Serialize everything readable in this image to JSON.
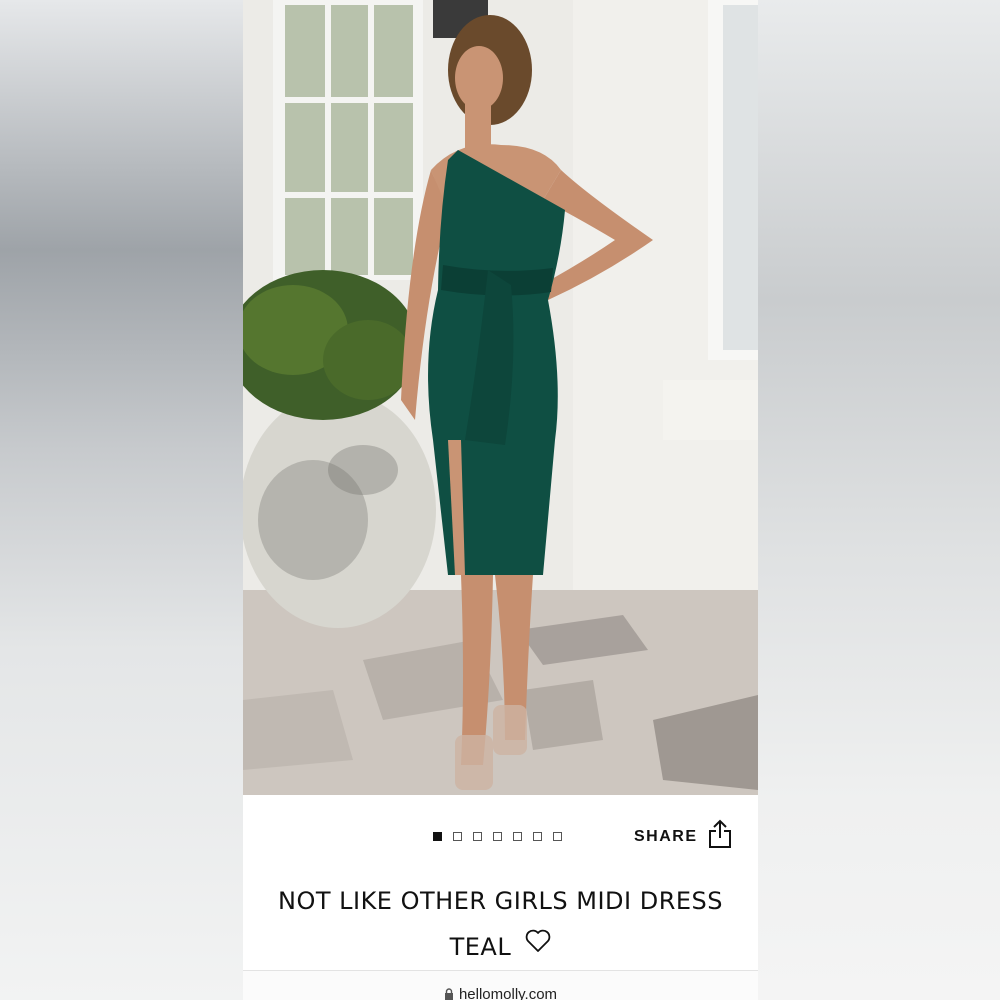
{
  "product": {
    "title_line1": "NOT LIKE OTHER GIRLS MIDI DRESS",
    "title_line2": "TEAL",
    "favorite_icon": "heart-outline-icon"
  },
  "gallery": {
    "image_count": 7,
    "active_index": 0,
    "image_alt": "Model wearing teal one-shoulder midi dress with tie waist"
  },
  "share": {
    "label": "SHARE",
    "icon": "share-icon"
  },
  "browser": {
    "url": "hellomolly.com",
    "icon": "lock-icon"
  },
  "colors": {
    "dress": "#0f4f43",
    "text": "#111111",
    "background": "#ffffff"
  }
}
